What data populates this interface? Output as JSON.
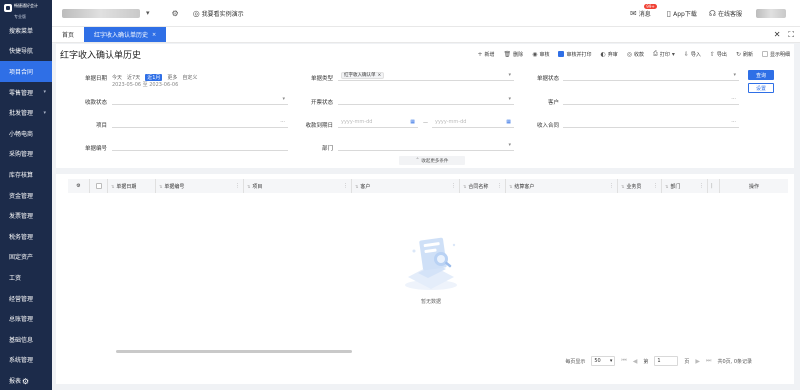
{
  "app": {
    "brand_line1": "畅捷通好会计",
    "brand_line2": "专业版"
  },
  "sidebar": {
    "items": [
      {
        "label": "搜索菜单",
        "arrow": ""
      },
      {
        "label": "快捷导航",
        "arrow": ""
      },
      {
        "label": "项目合同",
        "arrow": ""
      },
      {
        "label": "零售管理",
        "arrow": "▾"
      },
      {
        "label": "批发管理",
        "arrow": "▾"
      },
      {
        "label": "小畅电商",
        "arrow": ""
      },
      {
        "label": "采购管理",
        "arrow": ""
      },
      {
        "label": "库存核算",
        "arrow": ""
      },
      {
        "label": "资金管理",
        "arrow": ""
      },
      {
        "label": "发票管理",
        "arrow": ""
      },
      {
        "label": "税务管理",
        "arrow": ""
      },
      {
        "label": "固定资产",
        "arrow": ""
      },
      {
        "label": "工资",
        "arrow": ""
      },
      {
        "label": "经营管理",
        "arrow": ""
      },
      {
        "label": "总账管理",
        "arrow": ""
      },
      {
        "label": "基础信息",
        "arrow": ""
      },
      {
        "label": "系统管理",
        "arrow": ""
      },
      {
        "label": "报表",
        "arrow": ""
      }
    ]
  },
  "topbar": {
    "demo_label": "我要看实例演示",
    "messages_label": "消息",
    "messages_badge": "99+",
    "app_download_label": "App下载",
    "online_service_label": "在线客服"
  },
  "tabs": {
    "home": "首页",
    "current": "红字收入确认单历史",
    "close": "×"
  },
  "page": {
    "title": "红字收入确认单历史"
  },
  "toolbar": {
    "new": "新增",
    "delete": "删除",
    "audit": "审核",
    "audit_print": "审核并打印",
    "unaudit": "弃审",
    "collect": "收款",
    "print": "打印",
    "import": "导入",
    "export": "导出",
    "refresh": "刷新",
    "show_detail": "显示明细"
  },
  "filters": {
    "doc_date_label": "单据日期",
    "quick_today": "今天",
    "quick_7days": "近7天",
    "quick_month": "近1月",
    "quick_more": "更多",
    "quick_custom": "自定义",
    "date_range": "2023-05-06 至 2023-06-06",
    "doc_type_label": "单据类型",
    "doc_type_tag": "红字收入确认单",
    "doc_status_label": "单据状态",
    "collect_status_label": "收款状态",
    "invoice_status_label": "开票状态",
    "customer_label": "客户",
    "project_label": "项目",
    "due_date_label": "收款到期日",
    "date_placeholder": "yyyy-mm-dd",
    "date_sep": "—",
    "income_contract_label": "收入合同",
    "doc_number_label": "单据编号",
    "department_label": "部门",
    "query_button": "查询",
    "settings_button": "设置",
    "collapse_label": "收起更多条件"
  },
  "grid": {
    "columns": [
      "单据日期",
      "单据编号",
      "项目",
      "客户",
      "合同名称",
      "结算客户",
      "业务员",
      "部门",
      "操作"
    ],
    "empty_text": "暂无数据"
  },
  "pager": {
    "per_page_label": "每页显示",
    "per_page_value": "50",
    "page_prefix": "第",
    "page_value": "1",
    "page_suffix": "页",
    "summary": "共0页, 0条记录"
  },
  "colors": {
    "sidebar_bg": "#1c2b4a",
    "accent": "#2f6fe6"
  }
}
